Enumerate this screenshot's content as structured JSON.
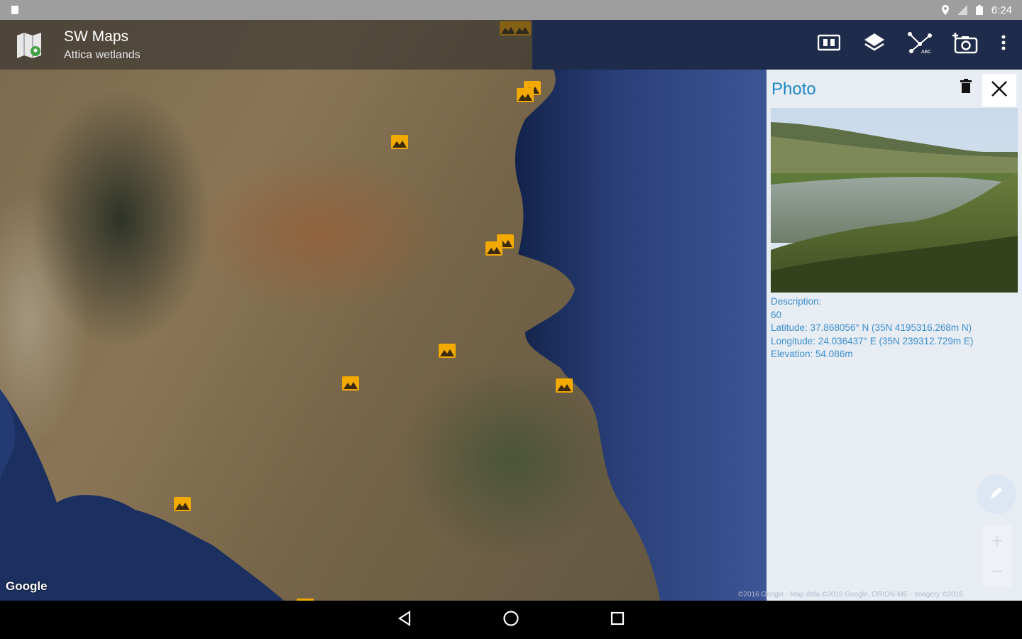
{
  "status_bar": {
    "time": "6:24"
  },
  "app": {
    "title": "SW Maps",
    "subtitle": "Attica wetlands"
  },
  "toolbar": [
    {
      "icon": "map-book-icon"
    },
    {
      "icon": "layers-icon"
    },
    {
      "icon": "measure-icon"
    },
    {
      "icon": "add-photo-icon"
    },
    {
      "icon": "more-vert-icon"
    }
  ],
  "map": {
    "logo": "Google",
    "attribution": "©2016 Google · Map data ©2016 Google, ORION-ME · Imagery ©2016"
  },
  "panel": {
    "title": "Photo",
    "description_label": "Description:",
    "description_value": "60",
    "latitude": "Latitude: 37.868056° N (35N 4195316.268m N)",
    "longitude": "Longitude: 24.036437° E (35N 239312.729m E)",
    "elevation": "Elevation: 54.086m"
  },
  "colors": {
    "accent": "#1e88c8",
    "toolbar_bg": "#1f2b4a",
    "panel_bg": "#e8ecf3"
  }
}
